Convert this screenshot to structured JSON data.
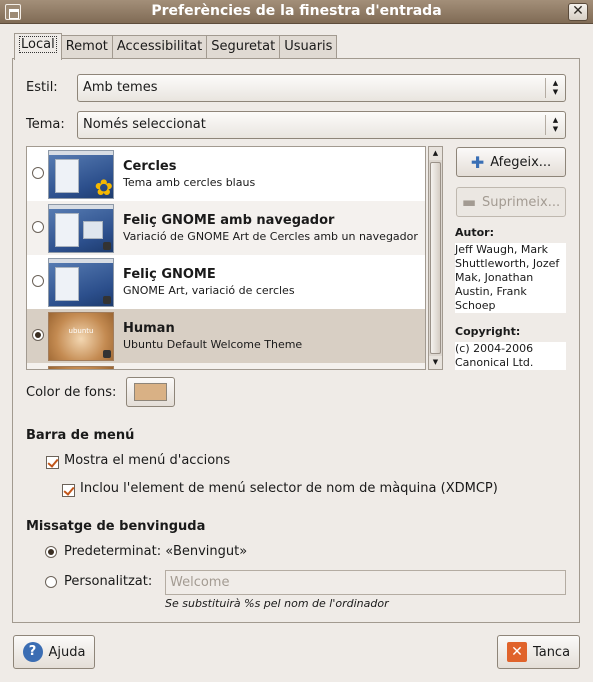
{
  "window": {
    "title": "Preferències de la finestra d'entrada",
    "close_glyph": "✕"
  },
  "tabs": [
    "Local",
    "Remot",
    "Accessibilitat",
    "Seguretat",
    "Usuaris"
  ],
  "style_row": {
    "label": "Estil:",
    "value": "Amb temes"
  },
  "theme_row": {
    "label": "Tema:",
    "value": "Només seleccionat"
  },
  "themes": [
    {
      "name": "Cercles",
      "description": "Tema amb cercles blaus",
      "selected": false
    },
    {
      "name": "Feliç GNOME amb navegador",
      "description": "Variació de GNOME Art de Cercles amb un navegador",
      "selected": false
    },
    {
      "name": "Feliç GNOME",
      "description": "GNOME Art, variació de cercles",
      "selected": false
    },
    {
      "name": "Human",
      "description": "Ubuntu Default Welcome Theme",
      "selected": true
    }
  ],
  "buttons": {
    "add": "Afegeix...",
    "remove": "Suprimeix...",
    "help": "Ajuda",
    "close": "Tanca"
  },
  "author": {
    "label": "Autor:",
    "lines": [
      "Jeff Waugh, Mark",
      "Shuttleworth, Jozef",
      "Mak, Jonathan",
      "Austin, Frank",
      "Schoep"
    ]
  },
  "copyright": {
    "label": "Copyright:",
    "lines": [
      "(c) 2004-2006",
      "Canonical Ltd."
    ]
  },
  "background": {
    "label": "Color de fons:",
    "color": "#d9b185"
  },
  "menu_bar": {
    "heading": "Barra de menú",
    "show_actions": "Mostra el menú d'accions",
    "include_chooser": "Inclou l'element de menú selector de nom de màquina (XDMCP)"
  },
  "welcome": {
    "heading": "Missatge de benvinguda",
    "default_label": "Predeterminat: «Benvingut»",
    "custom_label": "Personalitzat:",
    "custom_value": "Welcome",
    "hint": "Se substituirà %s pel nom de l'ordinador"
  },
  "colors": {
    "titlebar": "#8f7a63",
    "selected_row": "#d8cfc4",
    "accent": "#c2561a"
  }
}
